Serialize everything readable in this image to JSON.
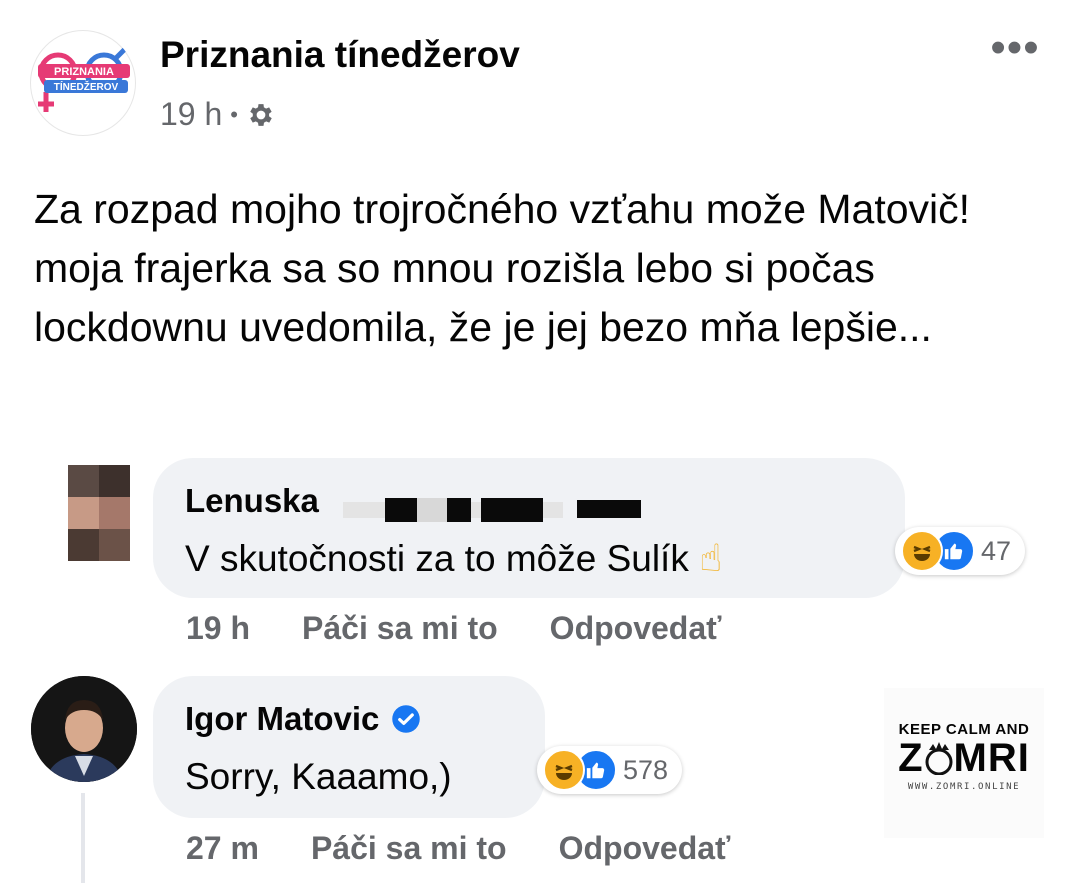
{
  "post": {
    "page_name": "Priznania tínedžerov",
    "time": "19 h",
    "separator": "•",
    "audience_icon": "gear-icon",
    "more_icon": "more-dots-icon",
    "more_label": "•••",
    "text": "Za rozpad mojho trojročného vzťahu može Matovič! moja frajerka sa so mnou rozišla lebo si počas lockdownu uvedomila, že je jej bezo mňa lepšie...",
    "logo": {
      "line1": "PRIZNANIA",
      "line2": "TÍNEDŽEROV"
    }
  },
  "comments": [
    {
      "author": "Lenuska",
      "author_redacted": true,
      "text": "V skutočnosti za to môže Sulík",
      "emoji": "☝",
      "reactions": [
        "haha",
        "like"
      ],
      "reaction_count": "47",
      "time": "19 h",
      "like_label": "Páči sa mi to",
      "reply_label": "Odpovedať"
    },
    {
      "author": "Igor Matovic",
      "verified": true,
      "text": "Sorry, Kaaamo,)",
      "reactions": [
        "haha",
        "like"
      ],
      "reaction_count": "578",
      "time": "27 m",
      "like_label": "Páči sa mi to",
      "reply_label": "Odpovedať"
    }
  ],
  "watermark": {
    "top": "KEEP CALM AND",
    "main_left": "Z",
    "main_right": "MRI",
    "url": "WWW.ZOMRI.ONLINE"
  },
  "colors": {
    "text": "#050505",
    "secondary": "#65676b",
    "bubble": "#f0f2f5",
    "like_blue": "#1877f2",
    "haha_yellow": "#f7b125",
    "verified_blue": "#1877f2",
    "logo_pink": "#e63a75",
    "logo_blue": "#3a78d8"
  }
}
